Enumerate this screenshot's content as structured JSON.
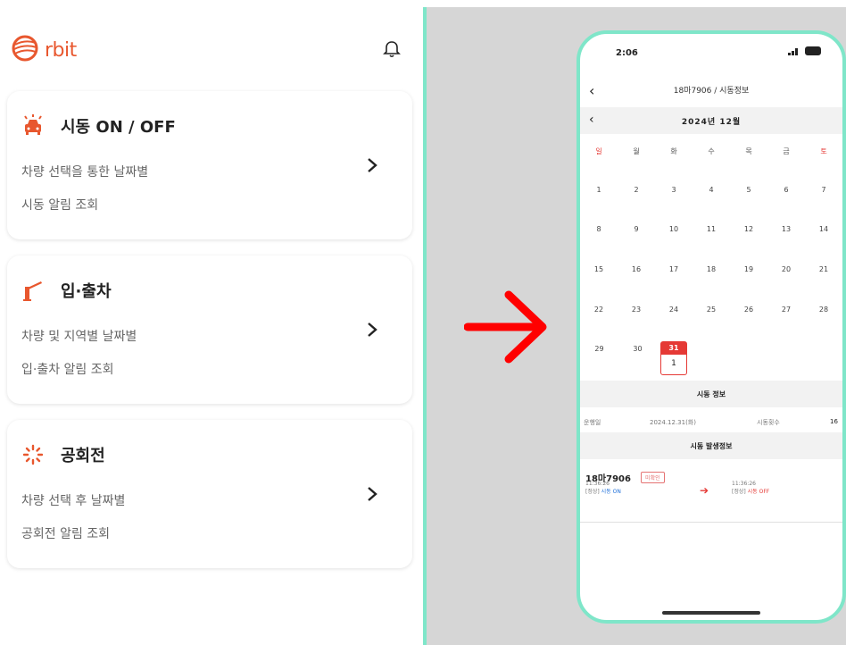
{
  "brand": {
    "logo_text": "rbit",
    "accent": "#e8572e"
  },
  "cards": [
    {
      "title": "시동 ON / OFF",
      "line1": "차량 선택을 통한 날짜별",
      "line2": "시동 알림 조회",
      "icon": "car-alarm-icon"
    },
    {
      "title": "입·출차",
      "line1": "차량 및 지역별 날짜별",
      "line2": "입·출차 알림 조회",
      "icon": "parking-gate-icon"
    },
    {
      "title": "공회전",
      "line1": "차량 선택 후 날짜별",
      "line2": "공회전 알림 조회",
      "icon": "idle-spinner-icon"
    }
  ],
  "phone": {
    "time": "2:06",
    "title": "18마7906 / 시동정보",
    "month": "2024년 12월",
    "weekdays": [
      "일",
      "월",
      "화",
      "수",
      "목",
      "금",
      "토"
    ],
    "weeks": [
      [
        "1",
        "2",
        "3",
        "4",
        "5",
        "6",
        "7"
      ],
      [
        "8",
        "9",
        "10",
        "11",
        "12",
        "13",
        "14"
      ],
      [
        "15",
        "16",
        "17",
        "18",
        "19",
        "20",
        "21"
      ],
      [
        "22",
        "23",
        "24",
        "25",
        "26",
        "27",
        "28"
      ],
      [
        "29",
        "30",
        "",
        "",
        "",
        "",
        ""
      ]
    ],
    "selected_day": "31",
    "selected_count": "1",
    "section1": "시동 정보",
    "info_label": "운행일",
    "info_date": "2024.12.31(화)",
    "info_label2": "시동횟수",
    "info_count": "16",
    "section2": "시동 발생정보",
    "car_no": "18마7906",
    "tag": "미확인",
    "on_time": "11:36:26",
    "on_label": "[정상]",
    "on_status": "시동 ON",
    "off_time": "11:36:26",
    "off_label": "[정상]",
    "off_status": "시동 OFF"
  }
}
